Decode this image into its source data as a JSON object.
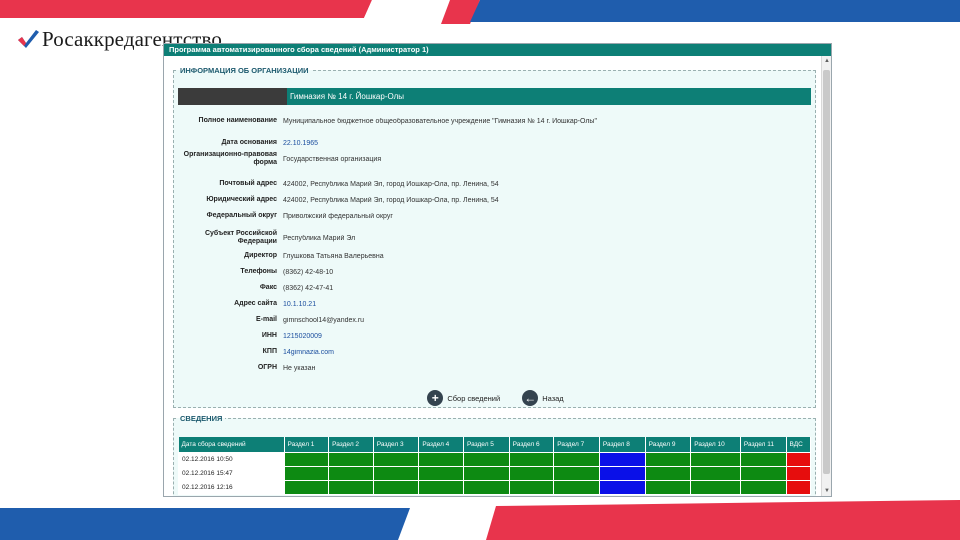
{
  "brand": {
    "name": "Росаккредагентство",
    "colors": {
      "red": "#e8344c",
      "blue": "#1f5dad",
      "window_accent": "#0d7f76"
    }
  },
  "window": {
    "title": "Программа автоматизированного сбора сведений (Администратор 1)"
  },
  "org_section": {
    "legend": "ИНФОРМАЦИЯ ОБ ОРГАНИЗАЦИИ",
    "name": "Гимназия № 14 г. Йошкар-Олы",
    "fields": [
      {
        "label": "Полное наименование",
        "value": "Муниципальное бюджетное общеобразовательное учреждение \"Гимназия № 14 г. Йошкар-Олы\"",
        "link": false
      },
      {
        "label": "Дата основания",
        "value": "22.10.1965",
        "link": true
      },
      {
        "label": "Организационно-правовая форма",
        "value": "Государственная организация",
        "link": false
      },
      {
        "label": "Почтовый адрес",
        "value": "424002, Республика Марий Эл, город Йошкар-Ола, пр. Ленина, 54",
        "link": false
      },
      {
        "label": "Юридический адрес",
        "value": "424002, Республика Марий Эл, город Йошкар-Ола, пр. Ленина, 54",
        "link": false
      },
      {
        "label": "Федеральный округ",
        "value": "Приволжский федеральный округ",
        "link": false
      },
      {
        "label": "Субъект Российской Федерации",
        "value": "Республика Марий Эл",
        "link": false
      },
      {
        "label": "Директор",
        "value": "Глушкова Татьяна Валерьевна",
        "link": false
      },
      {
        "label": "Телефоны",
        "value": "(8362) 42-48-10",
        "link": false
      },
      {
        "label": "Факс",
        "value": "(8362) 42-47-41",
        "link": false
      },
      {
        "label": "Адрес сайта",
        "value": "10.1.10.21",
        "link": true
      },
      {
        "label": "E-mail",
        "value": "gimnschool14@yandex.ru",
        "link": false
      },
      {
        "label": "ИНН",
        "value": "1215020009",
        "link": true
      },
      {
        "label": "КПП",
        "value": "14gimnazia.com",
        "link": true
      },
      {
        "label": "ОГРН",
        "value": "Не указан",
        "link": false
      }
    ],
    "buttons": {
      "collect": {
        "label": "Сбор сведений",
        "icon": "plus-icon"
      },
      "back": {
        "label": "Назад",
        "icon": "arrow-left-icon"
      }
    }
  },
  "sved_section": {
    "legend": "СВЕДЕНИЯ",
    "columns": [
      "Дата сбора сведений",
      "Раздел 1",
      "Раздел 2",
      "Раздел 3",
      "Раздел 4",
      "Раздел 5",
      "Раздел 6",
      "Раздел 7",
      "Раздел 8",
      "Раздел 9",
      "Раздел 10",
      "Раздел 11",
      "ВДС"
    ],
    "rows": [
      {
        "date": "02.12.2016 10:50",
        "status_colors": [
          "#0d8a12",
          "#0d8a12",
          "#0d8a12",
          "#0d8a12",
          "#0d8a12",
          "#0d8a12",
          "#0d8a12",
          "#0a10e8",
          "#0d8a12",
          "#0d8a12",
          "#0d8a12",
          "#e60d0d"
        ]
      },
      {
        "date": "02.12.2016 15:47",
        "status_colors": [
          "#0d8a12",
          "#0d8a12",
          "#0d8a12",
          "#0d8a12",
          "#0d8a12",
          "#0d8a12",
          "#0d8a12",
          "#0a10e8",
          "#0d8a12",
          "#0d8a12",
          "#0d8a12",
          "#e60d0d"
        ]
      },
      {
        "date": "02.12.2016 12:16",
        "status_colors": [
          "#0d8a12",
          "#0d8a12",
          "#0d8a12",
          "#0d8a12",
          "#0d8a12",
          "#0d8a12",
          "#0d8a12",
          "#0a10e8",
          "#0d8a12",
          "#0d8a12",
          "#0d8a12",
          "#e60d0d"
        ]
      }
    ]
  },
  "scrollbar": {
    "up_icon": "scroll-up-icon",
    "down_icon": "scroll-down-icon"
  }
}
